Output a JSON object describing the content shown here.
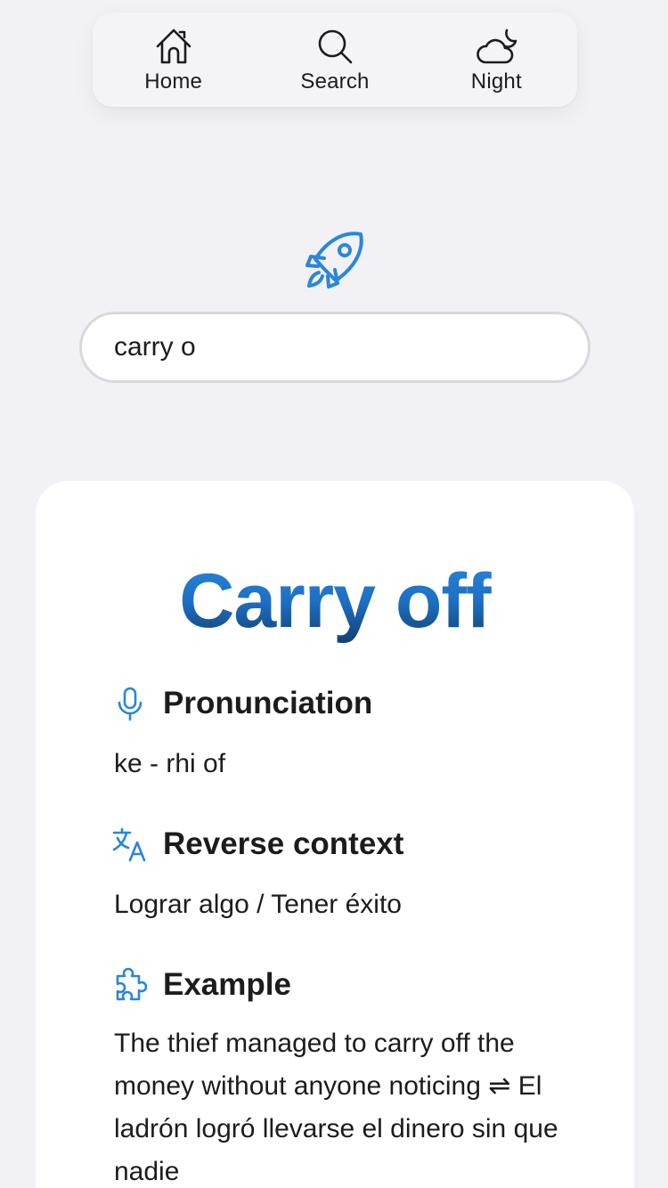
{
  "nav": {
    "home_label": "Home",
    "search_label": "Search",
    "night_label": "Night"
  },
  "search": {
    "value": "carry o"
  },
  "entry": {
    "word": "Carry off",
    "pronunciation": {
      "heading": "Pronunciation",
      "text": "ke - rhi of"
    },
    "reverse_context": {
      "heading": "Reverse context",
      "text": "Lograr algo / Tener éxito"
    },
    "example": {
      "heading": "Example",
      "text": "The thief managed to carry off the money without anyone noticing ⇌ El ladrón logró llevarse el dinero sin que nadie"
    }
  },
  "icons": {
    "nav": [
      "home-icon",
      "search-icon",
      "night-icon"
    ],
    "logo": "rocket-icon",
    "sections": [
      "microphone-icon",
      "translate-icon",
      "puzzle-icon"
    ]
  },
  "colors": {
    "accent": "#2a86d9",
    "background": "#f1f1f6",
    "card": "#ffffff"
  }
}
